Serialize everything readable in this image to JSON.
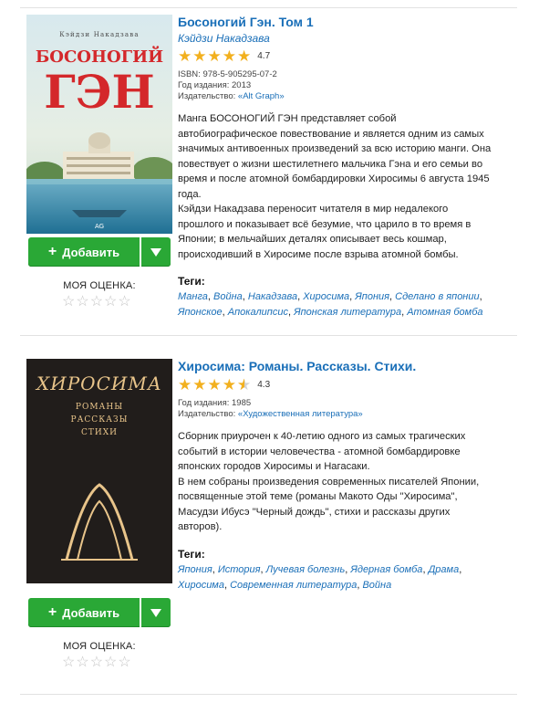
{
  "books": [
    {
      "title": "Босоногий Гэн. Том 1",
      "author": "Кэйдзи Накадзава",
      "rating": "4.7",
      "rating_value": 4.7,
      "isbn_label": "ISBN: 978-5-905295-07-2",
      "year_label": "Год издания: 2013",
      "publisher_prefix": "Издательство: ",
      "publisher": "«Alt Graph»",
      "description_lines": [
        "Манга БОСОНОГИЙ ГЭН представляет собой",
        "автобиографическое повествование и является одним из самых",
        "значимых антивоенных произведений за всю историю манги. Она",
        "повествует о жизни шестилетнего мальчика Гэна и его семьи во",
        "время и после атомной бомбардировки Хиросимы 6 августа 1945",
        "года.",
        "Кэйдзи Накадзава переносит читателя в мир недалекого",
        "прошлого и показывает всё безумие, что царило в то время в",
        "Японии; в мельчайших деталях описывает весь кошмар,",
        "происходивший в Хиросиме после взрыва атомной бомбы."
      ],
      "tags_label": "Теги:",
      "tags": [
        "Манга",
        "Война",
        "Накадзава",
        "Хиросима",
        "Япония",
        "Сделано в японии",
        "Японское",
        "Апокалипсис",
        "Японская литература",
        "Атомная бомба"
      ],
      "cover": {
        "author_text": "Кэйдзи Накадзава",
        "title_line1": "БОСОНОГИЙ",
        "title_line2": "ГЭН",
        "logo": "AG"
      },
      "add_label": "Добавить",
      "my_rating_label": "МОЯ ОЦЕНКА:"
    },
    {
      "title": "Хиросима: Романы. Рассказы. Стихи.",
      "rating": "4.3",
      "rating_value": 4.3,
      "year_label": "Год издания: 1985",
      "publisher_prefix": "Издательство: ",
      "publisher": "«Художественная литература»",
      "description_lines": [
        "Сборник приурочен к 40-летию одного из самых трагических",
        "событий в истории человечества - атомной бомбардировке",
        "японских городов Хиросимы и Нагасаки.",
        "В нем собраны произведения современных писателей Японии,",
        "посвященные этой теме (романы Макото Оды \"Хиросима\",",
        "Масудзи Ибусэ \"Черный дождь\", стихи и рассказы других",
        "авторов)."
      ],
      "tags_label": "Теги:",
      "tags": [
        "Япония",
        "История",
        "Лучевая болезнь",
        "Ядерная бомба",
        "Драма",
        "Хиросима",
        "Современная литература",
        "Война"
      ],
      "cover": {
        "title": "ХИРОСИМА",
        "sub1": "РОМАНЫ",
        "sub2": "РАССКАЗЫ",
        "sub3": "СТИХИ"
      },
      "add_label": "Добавить",
      "my_rating_label": "МОЯ ОЦЕНКА:"
    }
  ],
  "colors": {
    "link": "#1a6fb8",
    "button_green": "#2aa836",
    "star_gold": "#f2b01e",
    "star_empty": "#c5c5c5"
  },
  "icons": {
    "add": "plus-icon",
    "dropdown": "triangle-down-icon",
    "rating": "star-icon"
  }
}
